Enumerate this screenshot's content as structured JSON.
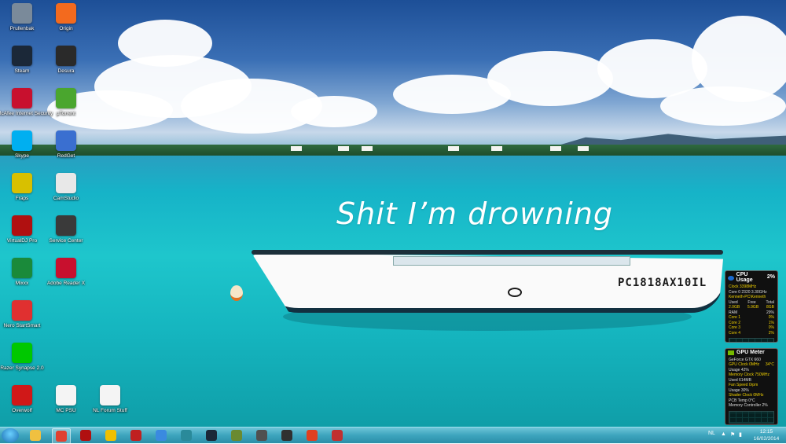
{
  "wallpaper": {
    "text": "Shit I’m drowning",
    "boat_registration": "PC1818AX10IL"
  },
  "desktop_icons": [
    {
      "label": "Prullenbak",
      "icon": "recycle-bin-icon",
      "color": "#7a8a9a"
    },
    {
      "label": "Origin",
      "icon": "origin-icon",
      "color": "#f36a1e"
    },
    {
      "label": "Steam",
      "icon": "steam-icon",
      "color": "#1b2838"
    },
    {
      "label": "Desura",
      "icon": "desura-icon",
      "color": "#2a2a2a"
    },
    {
      "label": "McAfee Internet Security",
      "icon": "mcafee-icon",
      "color": "#c8102e"
    },
    {
      "label": "µTorrent",
      "icon": "utorrent-icon",
      "color": "#4aa62e"
    },
    {
      "label": "Skype",
      "icon": "skype-icon",
      "color": "#00aff0"
    },
    {
      "label": "RedGet",
      "icon": "redget-icon",
      "color": "#3a6fd0"
    },
    {
      "label": "Fraps",
      "icon": "fraps-icon",
      "color": "#d8c000"
    },
    {
      "label": "CamStudio",
      "icon": "camstudio-icon",
      "color": "#e8e8e8"
    },
    {
      "label": "VirtualDJ Pro",
      "icon": "virtualdj-icon",
      "color": "#b01010"
    },
    {
      "label": "Service Center",
      "icon": "service-center-icon",
      "color": "#3a3a3a"
    },
    {
      "label": "Mixxx",
      "icon": "mixxx-icon",
      "color": "#1a8a3a"
    },
    {
      "label": "Adobe Reader X",
      "icon": "adobe-reader-icon",
      "color": "#c8102e"
    },
    {
      "label": "Nero StartSmart",
      "icon": "nero-icon",
      "color": "#e03030"
    },
    {
      "label": "Razer Synapse 2.0",
      "icon": "razer-icon",
      "color": "#00c800"
    },
    {
      "label": "Overwolf",
      "icon": "overwolf-icon",
      "color": "#d01818"
    },
    {
      "label": "MC PSU",
      "icon": "document-icon",
      "color": "#f4f4f4"
    },
    {
      "label": "NL Forum Stuff",
      "icon": "document-icon",
      "color": "#f4f4f4"
    }
  ],
  "cpu_gadget": {
    "title": "CPU Usage",
    "percent": "2%",
    "lines": [
      "Clock 3398MHz",
      "Core 0 2320 3.30GHz",
      "Kenneth-PC\\Kenneth"
    ],
    "header": [
      "Used",
      "Free",
      "Total"
    ],
    "mem": [
      "2.0GB",
      "5.9GB",
      "8GB"
    ],
    "mem_pct": "29%",
    "cores": [
      {
        "name": "Core 1",
        "pct": "0%"
      },
      {
        "name": "Core 2",
        "pct": "1%"
      },
      {
        "name": "Core 3",
        "pct": "0%"
      },
      {
        "name": "Core 4",
        "pct": "2%"
      }
    ]
  },
  "gpu_gadget": {
    "title": "GPU Meter",
    "lines": [
      "GeForce GTX 660",
      "GPU Clock 0MHz",
      "Usage 42%",
      "Memory Clock 750MHz",
      "Used 614MB",
      "Fan Speed 0rpm",
      "Usage 30%",
      "Shader Clock 0MHz",
      "PCB Temp 0°C",
      "Memory Controller 2%"
    ],
    "temp": "34°C"
  },
  "taskbar": {
    "items": [
      {
        "name": "explorer",
        "icon": "folder-icon",
        "color": "#f0c040"
      },
      {
        "name": "chrome",
        "icon": "chrome-icon",
        "color": "#e04030"
      },
      {
        "name": "virtualdj",
        "icon": "virtualdj-icon",
        "color": "#b01010"
      },
      {
        "name": "norton",
        "icon": "norton-icon",
        "color": "#f0c000"
      },
      {
        "name": "game",
        "icon": "game-icon",
        "color": "#c02020"
      },
      {
        "name": "itunes",
        "icon": "itunes-icon",
        "color": "#3a8ae0"
      },
      {
        "name": "skype-alt",
        "icon": "globe-icon",
        "color": "#2a8a9a"
      },
      {
        "name": "steam",
        "icon": "steam-icon",
        "color": "#1b2838"
      },
      {
        "name": "minecraft",
        "icon": "minecraft-icon",
        "color": "#6a8a30"
      },
      {
        "name": "settings",
        "icon": "gear-icon",
        "color": "#505050"
      },
      {
        "name": "soldier",
        "icon": "soldier-icon",
        "color": "#303030"
      },
      {
        "name": "channel4",
        "icon": "four-icon",
        "color": "#e04020"
      },
      {
        "name": "recorder",
        "icon": "recorder-icon",
        "color": "#c03030"
      }
    ],
    "language": "NL",
    "time": "12:15",
    "date": "16/02/2014"
  }
}
